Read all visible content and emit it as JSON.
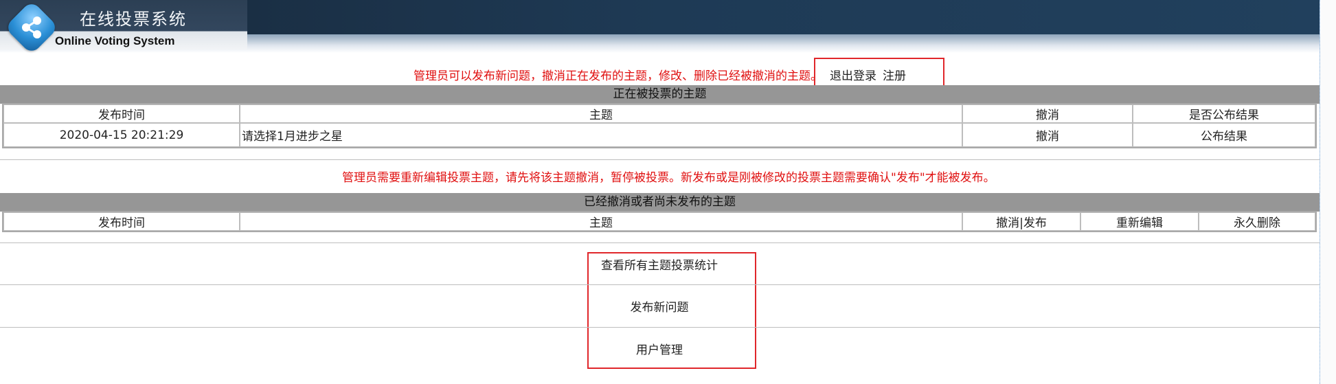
{
  "header": {
    "title_cn": "在线投票系统",
    "title_en": "Online Voting System",
    "logo_icon": "share-nodes-icon"
  },
  "top_notice": {
    "text": "管理员可以发布新问题，撤消正在发布的主题，修改、删除已经被撤消的主题。",
    "logout_label": "退出登录",
    "register_label": "注册"
  },
  "active_section": {
    "title": "正在被投票的主题",
    "columns": [
      "发布时间",
      "主题",
      "撤消",
      "是否公布结果"
    ],
    "rows": [
      {
        "time": "2020-04-15 20:21:29",
        "topic": "请选择1月进步之星",
        "cancel": "撤消",
        "publish": "公布结果"
      }
    ]
  },
  "middle_notice": {
    "text": "管理员需要重新编辑投票主题，请先将该主题撤消，暂停被投票。新发布或是刚被修改的投票主题需要确认\"发布\"才能被发布。"
  },
  "inactive_section": {
    "title": "已经撤消或者尚未发布的主题",
    "columns": [
      "发布时间",
      "主题",
      "撤消|发布",
      "重新编辑",
      "永久删除"
    ]
  },
  "menu": {
    "stats_label": "查看所有主题投票统计",
    "publish_label": "发布新问题",
    "users_label": "用户管理"
  },
  "colors": {
    "notice_red": "#e01010",
    "highlight_box": "#e0262a",
    "section_band": "#969696"
  }
}
